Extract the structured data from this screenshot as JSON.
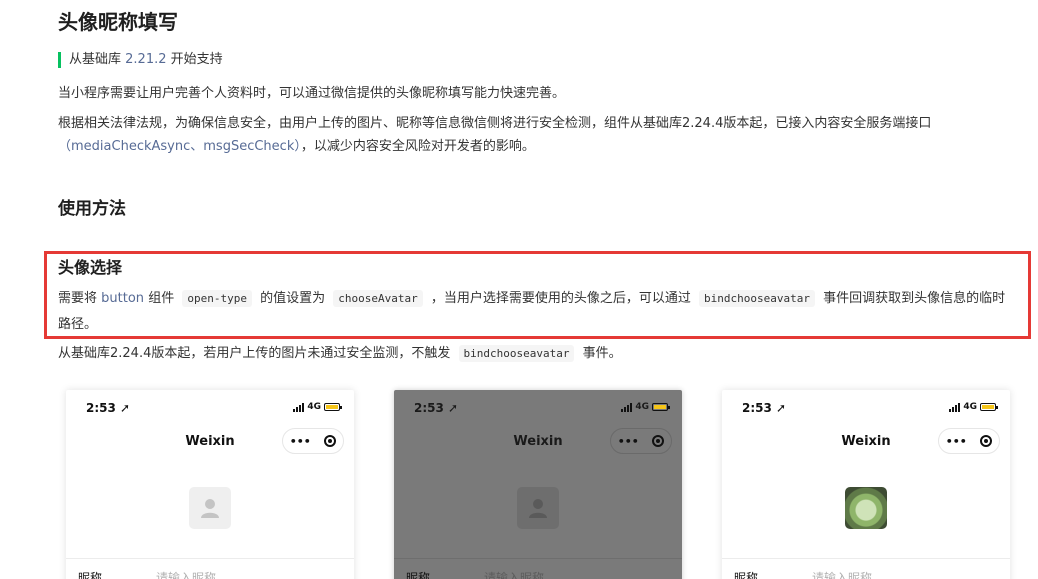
{
  "doc": {
    "title": "头像昵称填写",
    "since_prefix": "从基础库",
    "since_version": "2.21.2",
    "since_suffix": "开始支持",
    "para1": "当小程序需要让用户完善个人资料时，可以通过微信提供的头像昵称填写能力快速完善。",
    "para2_text": "根据相关法律法规，为确保信息安全，由用户上传的图片、昵称等信息微信侧将进行安全检测，组件从基础库2.24.4版本起，已接入内容安全服务端接口",
    "para2_link_open": "（",
    "para2_link1": "mediaCheckAsync",
    "para2_sep": "、",
    "para2_link2": "msgSecCheck",
    "para2_link_close": "）",
    "para2_tail": "，以减少内容安全风险对开发者的影响。",
    "usage_heading": "使用方法",
    "avatar_heading": "头像选择",
    "p3_a": "需要将",
    "p3_button_link": "button",
    "p3_b": "组件",
    "p3_code1": "open-type",
    "p3_c": "的值设置为",
    "p3_code2": "chooseAvatar",
    "p3_d": "，当用户选择需要使用的头像之后，可以通过",
    "p3_code3": "bindchooseavatar",
    "p3_e": "事件回调获取到头像信息的临时路径。",
    "p4_a": "从基础库2.24.4版本起，若用户上传的图片未通过安全监测，不触发",
    "p4_code": "bindchooseavatar",
    "p4_b": "事件。"
  },
  "phones": [
    {
      "time": "2:53",
      "network": "4G",
      "title": "Weixin",
      "dots": "•••",
      "label": "昵称",
      "placeholder": "请输入昵称"
    },
    {
      "time": "2:53",
      "network": "4G",
      "title": "Weixin",
      "dots": "•••",
      "label": "昵称",
      "placeholder": "请输入昵称"
    },
    {
      "time": "2:53",
      "network": "4G",
      "title": "Weixin",
      "dots": "•••",
      "label": "昵称",
      "placeholder": "请输入昵称"
    }
  ],
  "colors": {
    "accent_green": "#07c160",
    "link": "#576b95",
    "highlight_border": "#e53935",
    "battery": "#f5c518"
  },
  "icons": {
    "location": "location-arrow-icon",
    "signal": "signal-icon",
    "battery": "battery-icon",
    "more": "more-dots-icon",
    "record": "record-icon",
    "avatar": "user-placeholder-icon"
  }
}
